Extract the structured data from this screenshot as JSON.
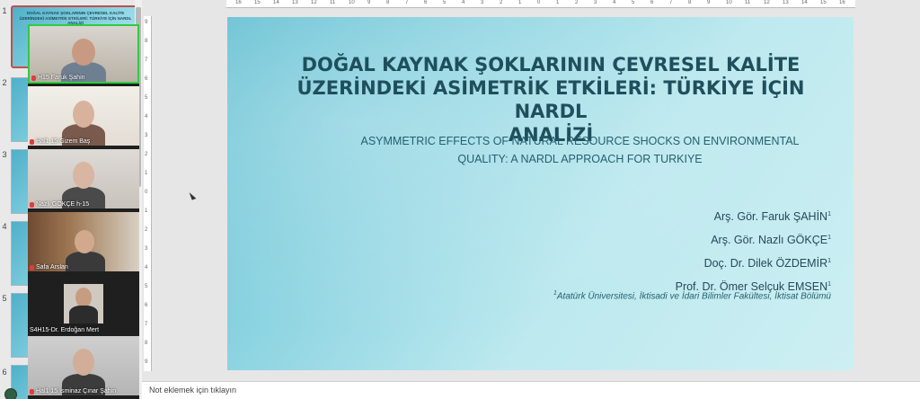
{
  "thumbnails": {
    "numbers": [
      "1",
      "2",
      "3",
      "4",
      "5",
      "6"
    ],
    "slide1_title": "DOĞAL KAYNAK ŞOKLARININ ÇEVRESEL KALİTE ÜZERİNDEKİ ASİMETRİK ETKİLERİ: TÜRKİYE İÇİN NARDL ANALİZİ"
  },
  "participants": [
    {
      "name": "H15 Faruk Şahin"
    },
    {
      "name": "Hal1 15 Gizem Baş"
    },
    {
      "name": "Nazlı GÖKÇE h-15"
    },
    {
      "name": "Safa Arslan"
    },
    {
      "name": "S4H15-Dr. Erdoğan Mert"
    },
    {
      "name": "Hal1 15 İsminaz Çınar Şahin"
    }
  ],
  "ruler": {
    "top": [
      "16",
      "15",
      "14",
      "13",
      "12",
      "11",
      "10",
      "9",
      "8",
      "7",
      "6",
      "5",
      "4",
      "3",
      "2",
      "1",
      "0",
      "1",
      "2",
      "3",
      "4",
      "5",
      "6",
      "7",
      "8",
      "9",
      "10",
      "11",
      "12",
      "13",
      "14",
      "15",
      "16"
    ],
    "left": [
      "9",
      "8",
      "7",
      "6",
      "5",
      "4",
      "3",
      "2",
      "1",
      "0",
      "1",
      "2",
      "3",
      "4",
      "5",
      "6",
      "7",
      "8",
      "9"
    ]
  },
  "slide": {
    "title_lines": [
      "DOĞAL KAYNAK ŞOKLARININ ÇEVRESEL KALİTE",
      "ÜZERİNDEKİ ASİMETRİK ETKİLERİ: TÜRKİYE İÇİN NARDL",
      "ANALİZİ"
    ],
    "subtitle_lines": [
      "ASYMMETRIC EFFECTS OF NATURAL RESOURCE SHOCKS ON ENVIRONMENTAL",
      "QUALITY: A NARDL APPROACH FOR TURKIYE"
    ],
    "authors": [
      "Arş. Gör. Faruk ŞAHİN",
      "Arş. Gör. Nazlı GÖKÇE",
      "Doç. Dr. Dilek ÖZDEMİR",
      "Prof. Dr. Ömer Selçuk EMSEN"
    ],
    "superscript": "1",
    "affiliation": "Atatürk Üniversitesi, İktisadi ve İdari Bilimler Fakültesi, İktisat Bölümü"
  },
  "notes": {
    "placeholder": "Not eklemek için tıklayın"
  },
  "colors": {
    "title": "#1f4f5c",
    "accent_border": "#c0504d",
    "active_speaker": "#2ecc40"
  }
}
